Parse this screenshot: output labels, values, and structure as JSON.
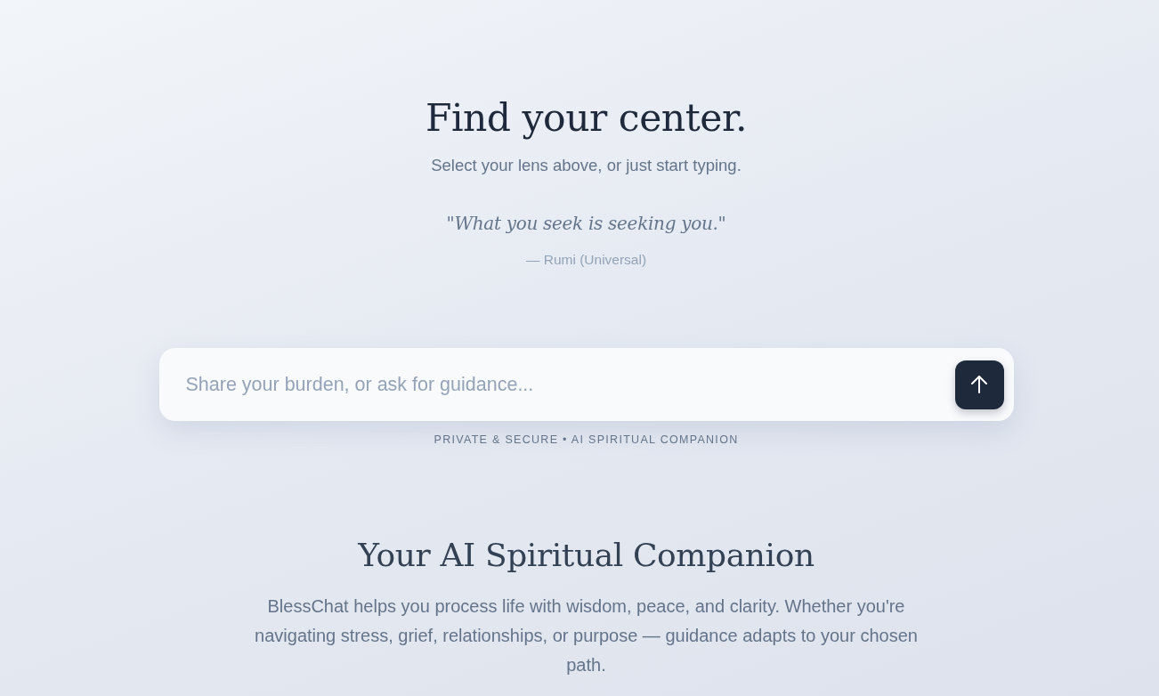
{
  "hero": {
    "title": "Find your center.",
    "subtitle": "Select your lens above, or just start typing.",
    "quote": {
      "text": "\"What you seek is seeking you.\"",
      "attribution": "— Rumi (Universal)"
    }
  },
  "composer": {
    "placeholder": "Share your burden, or ask for guidance...",
    "caption": "PRIVATE & SECURE • AI SPIRITUAL COMPANION"
  },
  "about": {
    "title": "Your AI Spiritual Companion",
    "body": "BlessChat helps you process life with wisdom, peace, and clarity. Whether you're navigating stress, grief, relationships, or purpose — guidance adapts to your chosen path."
  }
}
